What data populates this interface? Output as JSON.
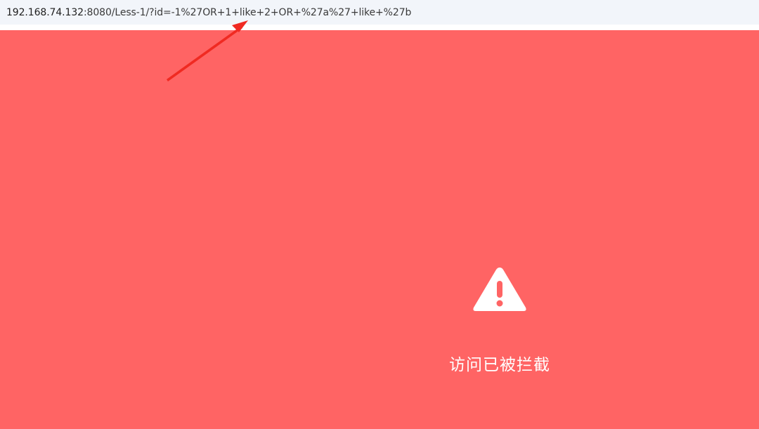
{
  "address_bar": {
    "url_host": "192.168.74.132",
    "url_rest": ":8080/Less-1/?id=-1%27OR+1+like+2+OR+%27a%27+like+%27b"
  },
  "block_page": {
    "message": "访问已被拦截",
    "icon": "warning-triangle-icon"
  },
  "colors": {
    "background": "#ff6464",
    "address_bar": "#f2f5fa",
    "annotation_arrow": "#f02a22",
    "text_on_block": "#ffffff"
  }
}
